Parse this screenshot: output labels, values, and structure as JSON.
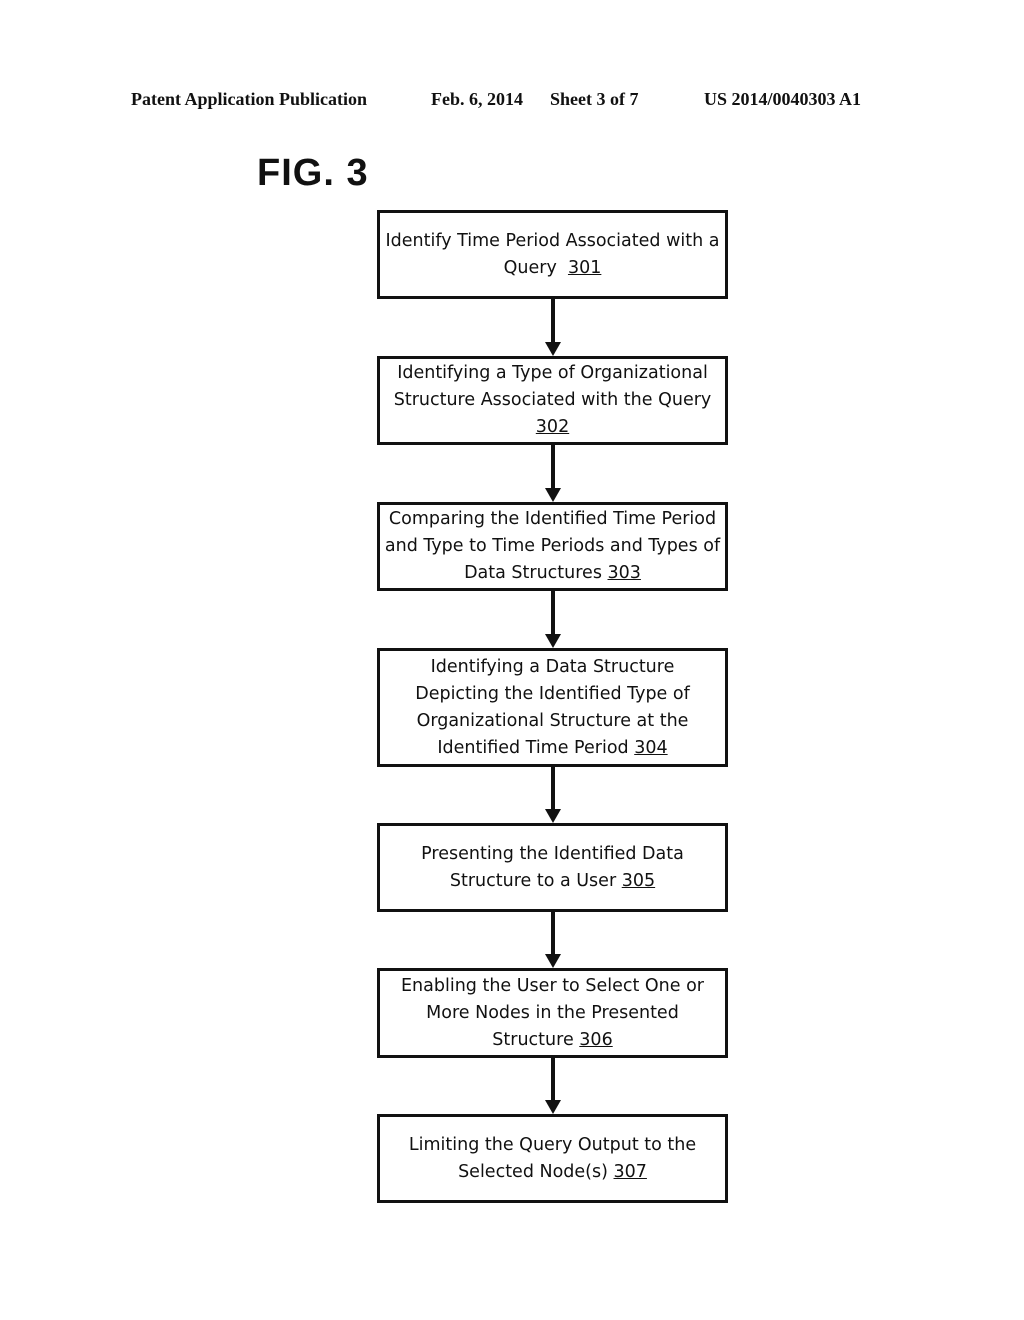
{
  "header": {
    "publication_type": "Patent Application Publication",
    "date": "Feb. 6, 2014",
    "sheet": "Sheet 3 of 7",
    "publication_number": "US 2014/0040303 A1"
  },
  "figure": {
    "label": "FIG. 3",
    "steps": [
      {
        "id": "301",
        "text": "Identify Time Period Associated with a Query",
        "ref": "301"
      },
      {
        "id": "302",
        "text": "Identifying a Type of Organizational Structure Associated with the Query",
        "ref": "302"
      },
      {
        "id": "303",
        "text": "Comparing the Identified Time Period and Type to Time Periods and Types of Data Structures",
        "ref": "303"
      },
      {
        "id": "304",
        "text": "Identifying a Data Structure Depicting the Identified Type of Organizational Structure at the Identified Time Period",
        "ref": "304"
      },
      {
        "id": "305",
        "text": "Presenting the Identified Data Structure to a User",
        "ref": "305"
      },
      {
        "id": "306",
        "text": "Enabling the User to Select One or More Nodes in the Presented Structure",
        "ref": "306"
      },
      {
        "id": "307",
        "text": "Limiting the Query Output to the Selected Node(s)",
        "ref": "307"
      }
    ],
    "edges": [
      {
        "from": "301",
        "to": "302"
      },
      {
        "from": "302",
        "to": "303"
      },
      {
        "from": "303",
        "to": "304"
      },
      {
        "from": "304",
        "to": "305"
      },
      {
        "from": "305",
        "to": "306"
      },
      {
        "from": "306",
        "to": "307"
      }
    ]
  }
}
